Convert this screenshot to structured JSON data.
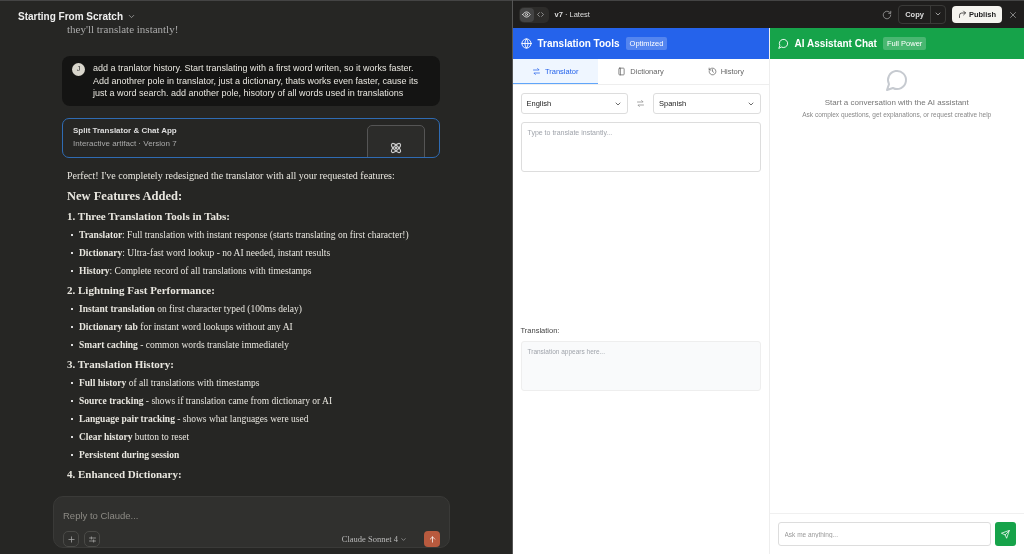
{
  "conversation": {
    "title": "Starting From Scratch"
  },
  "previous_text": "they'll translate instantly!",
  "user_message": {
    "avatar": "J",
    "text": "add a tranlator history. Start translating with a first word writen, so it works faster. Add anothrer pole in translator, just a dictionary, thats works even faster, cause its just a word search. add another pole, hisotory of all words used in translations"
  },
  "artifact_card": {
    "title": "Split Translator & Chat App",
    "subtitle": "Interactive artifact · Version 7"
  },
  "response": [
    {
      "kind": "paragraph",
      "text": "Perfect! I've completely redesigned the translator with all your requested features:"
    },
    {
      "kind": "h2",
      "text": "New Features Added:"
    },
    {
      "kind": "h3",
      "text": "1. Three Translation Tools in Tabs:"
    },
    {
      "kind": "bullet",
      "text": "**Translator**: Full translation with instant response (starts translating on first character!)"
    },
    {
      "kind": "bullet",
      "text": "**Dictionary**: Ultra-fast word lookup - no AI needed, instant results"
    },
    {
      "kind": "bullet",
      "text": "**History**: Complete record of all translations with timestamps"
    },
    {
      "kind": "h3",
      "text": "2. Lightning Fast Performance:"
    },
    {
      "kind": "bullet",
      "text": "**Instant translation** on first character typed (100ms delay)"
    },
    {
      "kind": "bullet",
      "text": "**Dictionary tab** for instant word lookups without any AI"
    },
    {
      "kind": "bullet",
      "text": "**Smart caching** - common words translate immediately"
    },
    {
      "kind": "h3",
      "text": "3. Translation History:"
    },
    {
      "kind": "bullet",
      "text": "**Full history** of all translations with timestamps"
    },
    {
      "kind": "bullet",
      "text": "**Source tracking** - shows if translation came from dictionary or AI"
    },
    {
      "kind": "bullet",
      "text": "**Language pair tracking** - shows what languages were used"
    },
    {
      "kind": "bullet",
      "text": "**Clear history** button to reset"
    },
    {
      "kind": "bullet",
      "text": "**Persistent during session**"
    },
    {
      "kind": "h3",
      "text": "4. Enhanced Dictionary:"
    }
  ],
  "composer": {
    "placeholder": "Reply to Claude...",
    "model": "Claude Sonnet 4"
  },
  "artifact_bar": {
    "views": [
      {
        "kind": "preview",
        "selected": true
      },
      {
        "kind": "code",
        "selected": false
      }
    ],
    "version": "**v7** · Latest",
    "copy": "Copy",
    "publish": "Publish"
  },
  "translator": {
    "title": "Translation Tools",
    "badge": "Optimized",
    "tabs": [
      {
        "kind": "translate",
        "label": "Translator",
        "selected": true
      },
      {
        "kind": "book",
        "label": "Dictionary",
        "selected": false
      },
      {
        "kind": "history",
        "label": "History",
        "selected": false
      }
    ],
    "source_language": "English",
    "target_language": "Spanish",
    "input_placeholder": "Type to translate instantly...",
    "output_label": "Translation:",
    "output_placeholder": "Translation appears here..."
  },
  "chat": {
    "title": "AI Assistant Chat",
    "badge": "Full Power",
    "empty_title": "Start a conversation with the AI assistant",
    "empty_subtitle": "Ask complex questions, get explanations, or request creative help",
    "input_placeholder": "Ask me anything..."
  }
}
